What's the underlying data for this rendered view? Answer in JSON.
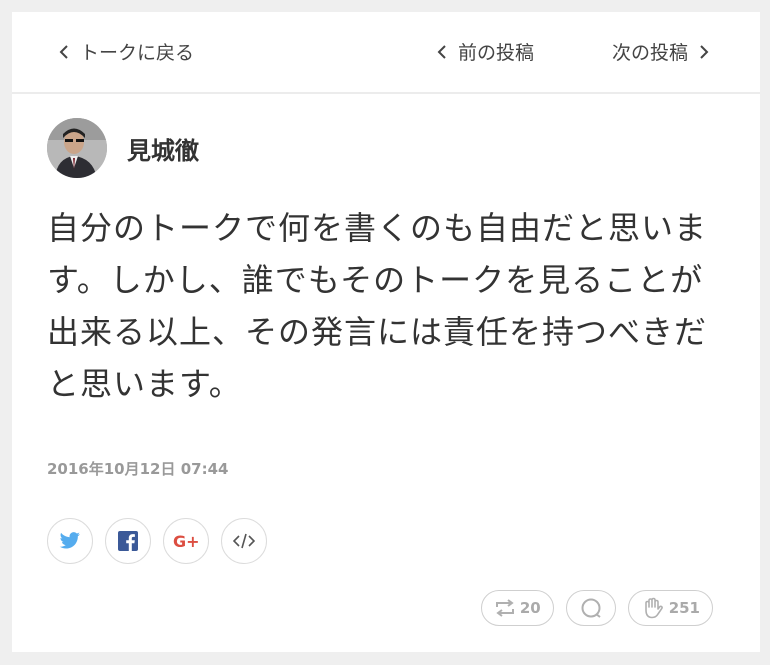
{
  "nav": {
    "back_label": "トークに戻る",
    "prev_label": "前の投稿",
    "next_label": "次の投稿"
  },
  "post": {
    "author": "見城徹",
    "text": "自分のトークで何を書くのも自由だと思います。しかし、誰でもそのトークを見ることが出来る以上、その発言には責任を持つべきだと思います。",
    "timestamp": "2016年10月12日 07:44"
  },
  "share": {
    "icons": [
      "twitter-icon",
      "facebook-icon",
      "google-plus-icon",
      "embed-icon"
    ],
    "colors": {
      "twitter": "#55acee",
      "facebook": "#3b5998",
      "google_plus": "#dc4e41",
      "embed": "#555555"
    }
  },
  "actions": {
    "repost_count": "20",
    "like_count": "251"
  }
}
